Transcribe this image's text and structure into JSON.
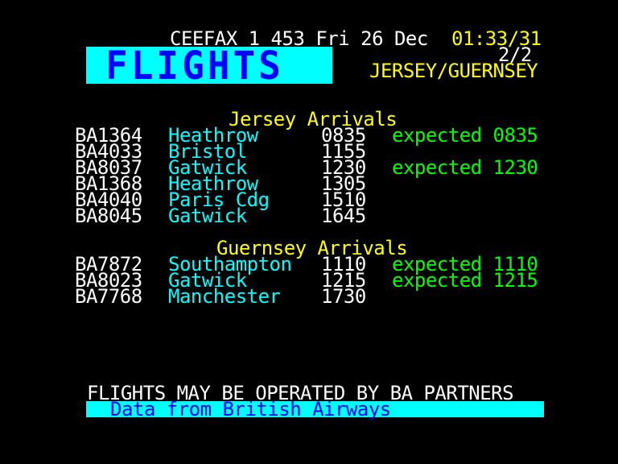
{
  "header": {
    "service": "CEEFAX 1 453 Fri 26 Dec",
    "clock": "01:33/31",
    "subpage": "2/2",
    "title": "FLIGHTS",
    "region": "JERSEY/GUERNSEY"
  },
  "sections": [
    {
      "heading": "Jersey Arrivals",
      "rows": [
        {
          "flight": "BA1364",
          "origin": "Heathrow",
          "time": "0835",
          "status": "expected 0835"
        },
        {
          "flight": "BA4033",
          "origin": "Bristol",
          "time": "1155",
          "status": ""
        },
        {
          "flight": "BA8037",
          "origin": "Gatwick",
          "time": "1230",
          "status": "expected 1230"
        },
        {
          "flight": "BA1368",
          "origin": "Heathrow",
          "time": "1305",
          "status": ""
        },
        {
          "flight": "BA4040",
          "origin": "Paris Cdg",
          "time": "1510",
          "status": ""
        },
        {
          "flight": "BA8045",
          "origin": "Gatwick",
          "time": "1645",
          "status": ""
        }
      ]
    },
    {
      "heading": "Guernsey Arrivals",
      "rows": [
        {
          "flight": "BA7872",
          "origin": "Southampton",
          "time": "1110",
          "status": "expected 1110"
        },
        {
          "flight": "BA8023",
          "origin": "Gatwick",
          "time": "1215",
          "status": "expected 1215"
        },
        {
          "flight": "BA7768",
          "origin": "Manchester",
          "time": "1730",
          "status": ""
        }
      ]
    }
  ],
  "footer": {
    "notice": "FLIGHTS MAY BE OPERATED BY BA PARTNERS",
    "source": "Data from British Airways"
  },
  "colors": {
    "background": "#000000",
    "white": "#ffffff",
    "yellow": "#ffff00",
    "cyan": "#00ffff",
    "green": "#00ff00",
    "blue": "#0000ff"
  }
}
